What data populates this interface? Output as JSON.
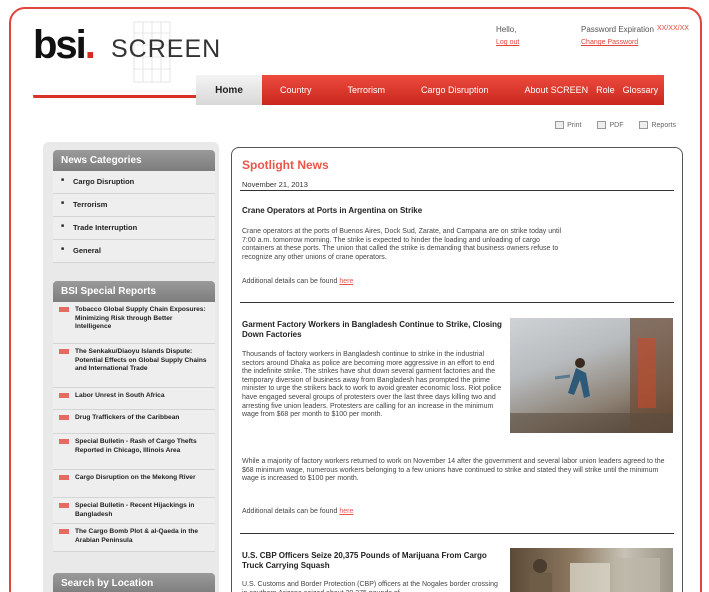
{
  "header": {
    "logo_text": "bsi",
    "logo_dot": ".",
    "product": "SCREEN",
    "hello_label": "Hello,",
    "hello_link": "Log out",
    "password_label": "Password Expiration",
    "password_value": "XX/XX/XX",
    "password_link": "Change Password"
  },
  "nav": {
    "home": "Home",
    "items": [
      "Country",
      "Terrorism",
      "Cargo Disruption",
      "About SCREEN",
      "Role",
      "Glossary"
    ]
  },
  "utils": {
    "print": "Print",
    "pdf": "PDF",
    "reports": "Reports"
  },
  "sidebar": {
    "categories_title": "News Categories",
    "categories": [
      "Cargo Disruption",
      "Terrorism",
      "Trade Interruption",
      "General"
    ],
    "reports_title": "BSI Special Reports",
    "reports": [
      "Tobacco Global Supply Chain Exposures: Minimizing Risk through Better Intelligence",
      "The Senkaku/Diaoyu Islands Dispute: Potential Effects on Global Supply Chains and International Trade",
      "Labor Unrest in South Africa",
      "Drug Traffickers of the Caribbean",
      "Special Bulletin - Rash of Cargo Thefts Reported in Chicago, Illinois Area",
      "Cargo Disruption on the Mekong River",
      "Special Bulletin - Recent Hijackings in Bangladesh",
      "The Cargo Bomb Plot & al-Qaeda in the Arabian Peninsula"
    ],
    "location_title": "Search by Location"
  },
  "main": {
    "title": "Spotlight News",
    "date": "November 21, 2013",
    "more_label": "Additional details can be found",
    "more_link": "here",
    "articles": [
      {
        "title": "Crane Operators at Ports in Argentina on Strike",
        "body": "Crane operators at the ports of Buenos Aires, Dock Sud, Zarate, and Campana are on strike today until 7:00 a.m. tomorrow morning. The strike is expected to hinder the loading and unloading of cargo containers at these ports. The union that called the strike is demanding that business owners refuse to recognize any other unions of crane operators."
      },
      {
        "title": "Garment Factory Workers in Bangladesh Continue to Strike, Closing Down Factories",
        "body": "Thousands of factory workers in Bangladesh continue to strike in the industrial sectors around Dhaka as police are becoming more aggressive in an effort to end the indefinite strike. The strikes have shut down several garment factories and the temporary diversion of business away from Bangladesh has prompted the prime minister to urge the strikers back to work to avoid greater economic loss. Riot police have engaged several groups of protesters over the last three days killing two and arresting five union leaders. Protesters are calling for an increase in the minimum wage from $68 per month to $100 per month.",
        "body2": "While a majority of factory workers returned to work on November 14 after the government and several labor union leaders agreed to the $68 minimum wage, numerous workers belonging to a few unions have continued to strike and stated they will strike until the minimum wage is increased to $100 per month."
      },
      {
        "title": "U.S. CBP Officers Seize 20,375 Pounds of Marijuana From Cargo Truck Carrying Squash",
        "body": "U.S. Customs and Border Protection (CBP) officers at the Nogales border crossing in southern Arizona seized about 20,375 pounds of"
      }
    ]
  }
}
